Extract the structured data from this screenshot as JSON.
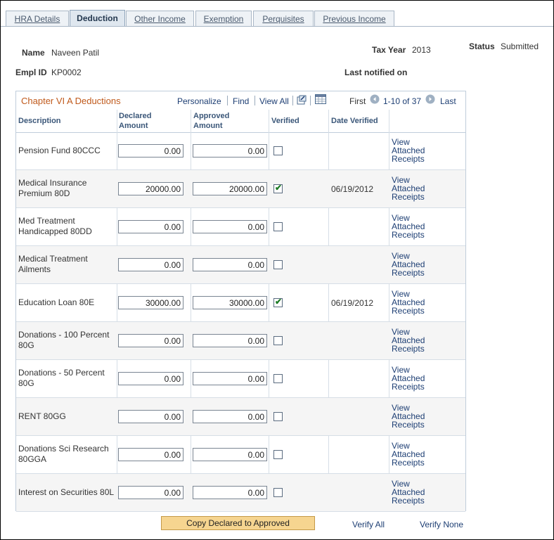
{
  "tabs": [
    "HRA Details",
    "Deduction",
    "Other Income",
    "Exemption",
    "Perquisites",
    "Previous Income"
  ],
  "header": {
    "name_label": "Name",
    "name_value": "Naveen Patil",
    "tax_year_label": "Tax Year",
    "tax_year_value": "2013",
    "status_label": "Status",
    "status_value": "Submitted",
    "emplid_label": "Empl ID",
    "emplid_value": "KP0002",
    "last_notified_label": "Last notified on"
  },
  "grid": {
    "title": "Chapter VI A Deductions",
    "personalize": "Personalize",
    "find": "Find",
    "view_all": "View All",
    "first": "First",
    "range": "1-10 of 37",
    "last": "Last",
    "columns": [
      "Description",
      "Declared Amount",
      "Approved Amount",
      "Verified",
      "Date Verified"
    ],
    "rows": [
      {
        "desc": "Pension Fund 80CCC",
        "declared": "0.00",
        "approved": "0.00",
        "verified": false,
        "date": "",
        "link": "View Attached Receipts"
      },
      {
        "desc": "Medical Insurance Premium 80D",
        "declared": "20000.00",
        "approved": "20000.00",
        "verified": true,
        "date": "06/19/2012",
        "link": "View Attached Receipts"
      },
      {
        "desc": "Med Treatment Handicapped 80DD",
        "declared": "0.00",
        "approved": "0.00",
        "verified": false,
        "date": "",
        "link": "View Attached Receipts"
      },
      {
        "desc": "Medical Treatment Ailments",
        "declared": "0.00",
        "approved": "0.00",
        "verified": false,
        "date": "",
        "link": "View Attached Receipts"
      },
      {
        "desc": "Education Loan 80E",
        "declared": "30000.00",
        "approved": "30000.00",
        "verified": true,
        "date": "06/19/2012",
        "link": "View Attached Receipts"
      },
      {
        "desc": "Donations - 100 Percent 80G",
        "declared": "0.00",
        "approved": "0.00",
        "verified": false,
        "date": "",
        "link": "View Attached Receipts"
      },
      {
        "desc": "Donations - 50 Percent 80G",
        "declared": "0.00",
        "approved": "0.00",
        "verified": false,
        "date": "",
        "link": "View Attached Receipts"
      },
      {
        "desc": "RENT 80GG",
        "declared": "0.00",
        "approved": "0.00",
        "verified": false,
        "date": "",
        "link": "View Attached Receipts"
      },
      {
        "desc": "Donations Sci Research 80GGA",
        "declared": "0.00",
        "approved": "0.00",
        "verified": false,
        "date": "",
        "link": "View Attached Receipts"
      },
      {
        "desc": "Interest on Securities 80L",
        "declared": "0.00",
        "approved": "0.00",
        "verified": false,
        "date": "",
        "link": "View Attached Receipts"
      }
    ]
  },
  "actions": {
    "copy": "Copy Declared to Approved",
    "verify_all": "Verify All",
    "verify_none": "Verify None"
  },
  "colors": {
    "grid_title": "#c05a1c",
    "link": "#1d3e73",
    "header_text": "#3a5678",
    "button_bg": "#f6d590",
    "check": "#1a7a22"
  }
}
